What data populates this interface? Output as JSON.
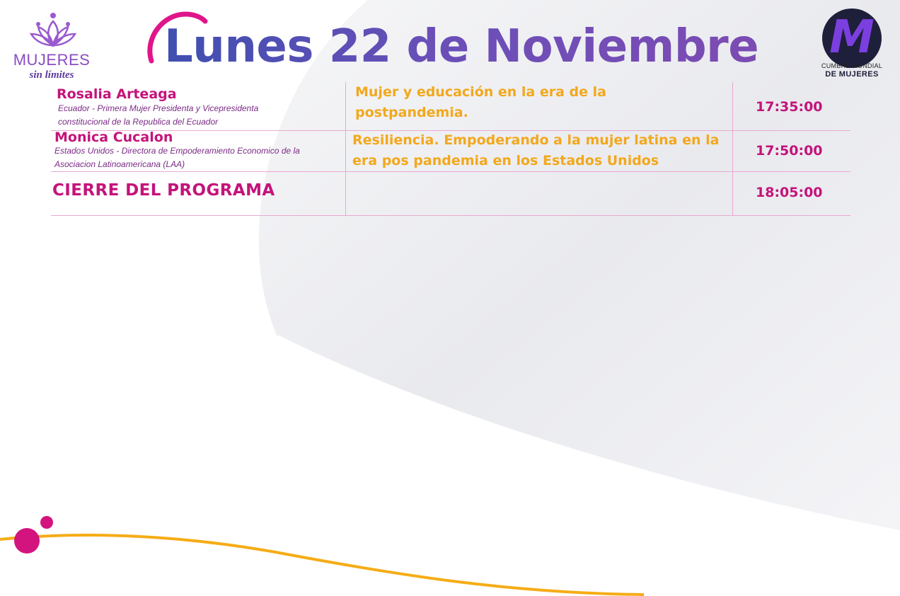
{
  "header": {
    "title": "Lunes 22 de Noviembre",
    "left_logo": {
      "line1": "MUJERES",
      "line2": "sin límites",
      "icon": "lotus-crown-icon"
    },
    "right_logo": {
      "letter": "M",
      "line1": "CUMBRE MUNDIAL",
      "line2": "DE MUJERES"
    }
  },
  "schedule": {
    "rows": [
      {
        "speaker": "Rosalia Arteaga",
        "description": "Ecuador - Primera Mujer Presidenta y Vicepresidenta constitucional de la Republica del Ecuador",
        "topic": "Mujer y educación en la era de la postpandemia.",
        "time": "17:35:00"
      },
      {
        "speaker": "Monica Cucalon",
        "description": "Estados Unidos - Directora de Empoderamiento Economico de la Asociacion Latinoamericana (LAA)",
        "topic": "Resiliencia. Empoderando a la mujer latina en la era pos pandemia en los Estados Unidos",
        "time": "17:50:00"
      },
      {
        "speaker": "CIERRE DEL PROGRAMA",
        "time": "18:05:00"
      }
    ]
  },
  "colors": {
    "magenta": "#c4137a",
    "orange": "#f2a81d",
    "title_blue": "#3f4fb0",
    "title_purple": "#7c4bb3",
    "divider": "#e9a8cf"
  }
}
